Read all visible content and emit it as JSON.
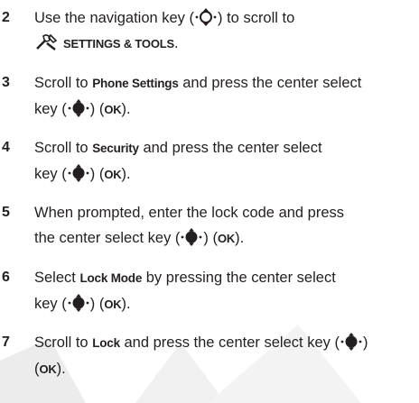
{
  "steps": [
    {
      "number": "2",
      "line1_pre": "Use the navigation key (",
      "line1_post": ") to scroll to",
      "menu_label": "SETTINGS & TOOLS",
      "menu_tail": "."
    },
    {
      "number": "3",
      "line1_pre": "Scroll to ",
      "ui": "Phone Settings",
      "line1_post": " and press the center select",
      "line2_pre": "key (",
      "line2_mid": ") (",
      "ok": "OK",
      "line2_post": ")."
    },
    {
      "number": "4",
      "line1_pre": "Scroll to ",
      "ui": "Security",
      "line1_post": " and press the center select",
      "line2_pre": "key (",
      "line2_mid": ") (",
      "ok": "OK",
      "line2_post": ")."
    },
    {
      "number": "5",
      "line1": "When prompted, enter the lock code and press",
      "line2_pre": "the center select key (",
      "line2_mid": ") (",
      "ok": "OK",
      "line2_post": ")."
    },
    {
      "number": "6",
      "line1_pre": "Select ",
      "ui": "Lock Mode",
      "line1_post": " by pressing the center select",
      "line2_pre": "key (",
      "line2_mid": ") (",
      "ok": "OK",
      "line2_post": ")."
    },
    {
      "number": "7",
      "line1_pre": "Scroll to ",
      "ui": "Lock",
      "line1_post": " and press the center select key (",
      "line1_end": ")",
      "line2_pre": "(",
      "ok": "OK",
      "line2_post": ")."
    }
  ],
  "icons": {
    "navigation_key": "navigation-key-icon",
    "center_select_key": "center-select-key-icon",
    "settings_tools": "settings-tools-icon"
  },
  "colors": {
    "text": "#231f20",
    "watermark": "#e6e6e6"
  }
}
